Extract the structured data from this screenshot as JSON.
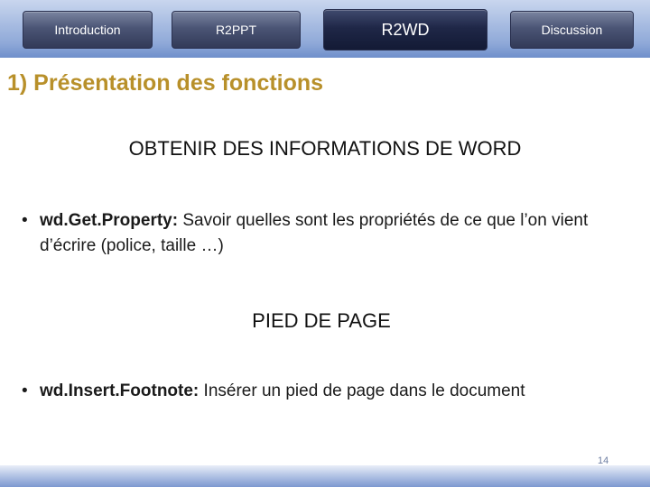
{
  "nav": {
    "tabs": [
      {
        "label": "Introduction"
      },
      {
        "label": "R2PPT"
      },
      {
        "label": "R2WD"
      },
      {
        "label": "Discussion"
      }
    ]
  },
  "slide": {
    "title": "1) Présentation des fonctions",
    "section1_heading": "OBTENIR DES INFORMATIONS DE WORD",
    "bullet1_term": "wd.Get.Property:",
    "bullet1_text": " Savoir quelles sont les propriétés de ce que l’on vient d’écrire (police, taille …)",
    "section2_heading": "PIED DE PAGE",
    "bullet2_term": "wd.Insert.Footnote:",
    "bullet2_text": " Insérer un pied de page dans le document",
    "bullet_glyph": "•",
    "page_number": "14"
  },
  "colors": {
    "title": "#b8902a",
    "tab_text": "#ffffff",
    "body_text": "#1a1a1a"
  }
}
